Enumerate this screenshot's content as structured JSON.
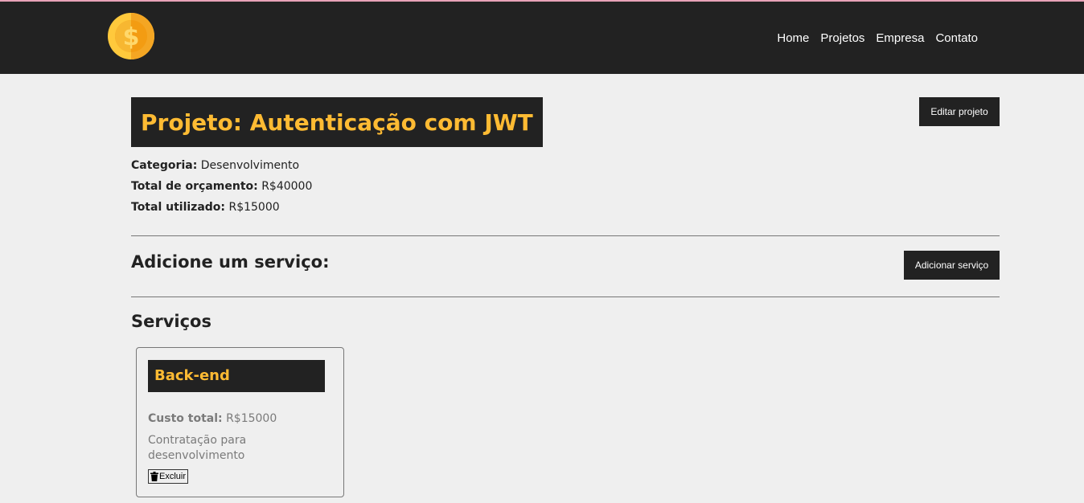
{
  "nav": {
    "logo_icon": "dollar-coin-icon",
    "links": [
      "Home",
      "Projetos",
      "Empresa",
      "Contato"
    ]
  },
  "project": {
    "title": "Projeto: Autenticação com JWT",
    "edit_label": "Editar projeto",
    "category_label": "Categoria:",
    "category_value": "Desenvolvimento",
    "budget_label": "Total de orçamento:",
    "budget_value": "R$40000",
    "used_label": "Total utilizado:",
    "used_value": "R$15000"
  },
  "add_service": {
    "heading": "Adicione um serviço:",
    "button_label": "Adicionar serviço"
  },
  "services": {
    "heading": "Serviços",
    "items": [
      {
        "name": "Back-end",
        "cost_label": "Custo total:",
        "cost_value": "R$15000",
        "description": "Contratação para desenvolvimento",
        "delete_label": "Excluir",
        "delete_icon": "trash-icon"
      }
    ]
  },
  "colors": {
    "navbar": "#222222",
    "accent": "#ffbb33",
    "background": "#efefef"
  }
}
